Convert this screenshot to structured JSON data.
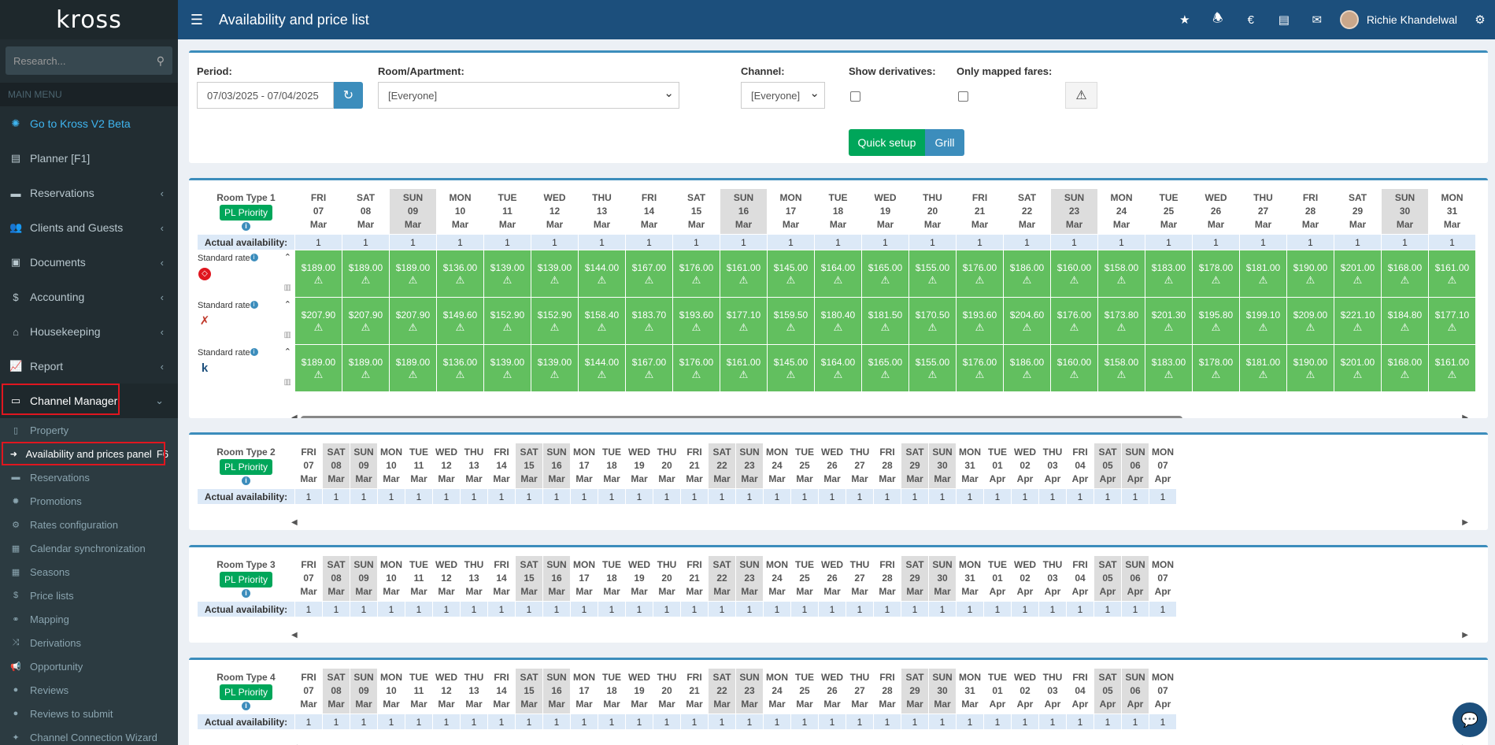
{
  "app": {
    "logo": "kross",
    "page_title": "Availability and price list"
  },
  "search": {
    "placeholder": "Research..."
  },
  "sidebar": {
    "menu_header": "MAIN MENU",
    "items": [
      {
        "label": "Go to Kross V2 Beta",
        "icon": "flower-icon"
      },
      {
        "label": "Planner [F1]",
        "icon": "planner-icon"
      },
      {
        "label": "Reservations",
        "icon": "book-icon"
      },
      {
        "label": "Clients and Guests",
        "icon": "users-icon"
      },
      {
        "label": "Documents",
        "icon": "document-icon"
      },
      {
        "label": "Accounting",
        "icon": "dollar-icon"
      },
      {
        "label": "Housekeeping",
        "icon": "house-icon"
      },
      {
        "label": "Report",
        "icon": "chart-icon"
      },
      {
        "label": "Channel Manager",
        "icon": "monitor-icon"
      }
    ],
    "sub_items": [
      {
        "label": "Property",
        "icon": "file-icon"
      },
      {
        "label": "Availability and prices panel",
        "shortcut": "F6",
        "icon": "login-icon"
      },
      {
        "label": "Reservations",
        "icon": "book-icon"
      },
      {
        "label": "Promotions",
        "icon": "certificate-icon"
      },
      {
        "label": "Rates configuration",
        "icon": "gear-icon"
      },
      {
        "label": "Calendar synchronization",
        "icon": "calendar-icon"
      },
      {
        "label": "Seasons",
        "icon": "calendar-icon"
      },
      {
        "label": "Price lists",
        "icon": "dollar-icon"
      },
      {
        "label": "Mapping",
        "icon": "link-icon"
      },
      {
        "label": "Derivations",
        "icon": "shuffle-icon"
      },
      {
        "label": "Opportunity",
        "icon": "bullhorn-icon"
      },
      {
        "label": "Reviews",
        "icon": "comment-icon"
      },
      {
        "label": "Reviews to submit",
        "icon": "comment-icon"
      },
      {
        "label": "Channel Connection Wizard",
        "icon": "wand-icon"
      }
    ]
  },
  "topbar": {
    "user_name": "Richie Khandelwal",
    "euro": "€"
  },
  "filters": {
    "period_label": "Period:",
    "period_value": "07/03/2025 - 07/04/2025",
    "room_label": "Room/Apartment:",
    "room_value": "[Everyone]",
    "channel_label": "Channel:",
    "channel_value": "[Everyone]",
    "derivatives_label": "Show derivatives:",
    "mapped_label": "Only mapped fares:",
    "quick_setup": "Quick setup",
    "grill": "Grill"
  },
  "grid": {
    "pl_priority": "PL Priority",
    "actual_availability": "Actual availability:",
    "standard_rate": "Standard rate",
    "rt1_days": [
      [
        "FRI",
        "07",
        "Mar",
        0
      ],
      [
        "SAT",
        "08",
        "Mar",
        0
      ],
      [
        "SUN",
        "09",
        "Mar",
        1
      ],
      [
        "MON",
        "10",
        "Mar",
        0
      ],
      [
        "TUE",
        "11",
        "Mar",
        0
      ],
      [
        "WED",
        "12",
        "Mar",
        0
      ],
      [
        "THU",
        "13",
        "Mar",
        0
      ],
      [
        "FRI",
        "14",
        "Mar",
        0
      ],
      [
        "SAT",
        "15",
        "Mar",
        0
      ],
      [
        "SUN",
        "16",
        "Mar",
        1
      ],
      [
        "MON",
        "17",
        "Mar",
        0
      ],
      [
        "TUE",
        "18",
        "Mar",
        0
      ],
      [
        "WED",
        "19",
        "Mar",
        0
      ],
      [
        "THU",
        "20",
        "Mar",
        0
      ],
      [
        "FRI",
        "21",
        "Mar",
        0
      ],
      [
        "SAT",
        "22",
        "Mar",
        0
      ],
      [
        "SUN",
        "23",
        "Mar",
        1
      ],
      [
        "MON",
        "24",
        "Mar",
        0
      ],
      [
        "TUE",
        "25",
        "Mar",
        0
      ],
      [
        "WED",
        "26",
        "Mar",
        0
      ],
      [
        "THU",
        "27",
        "Mar",
        0
      ],
      [
        "FRI",
        "28",
        "Mar",
        0
      ],
      [
        "SAT",
        "29",
        "Mar",
        0
      ],
      [
        "SUN",
        "30",
        "Mar",
        1
      ],
      [
        "MON",
        "31",
        "Mar",
        0
      ]
    ],
    "all_days": [
      [
        "FRI",
        "07",
        "Mar",
        0
      ],
      [
        "SAT",
        "08",
        "Mar",
        1
      ],
      [
        "SUN",
        "09",
        "Mar",
        1
      ],
      [
        "MON",
        "10",
        "Mar",
        0
      ],
      [
        "TUE",
        "11",
        "Mar",
        0
      ],
      [
        "WED",
        "12",
        "Mar",
        0
      ],
      [
        "THU",
        "13",
        "Mar",
        0
      ],
      [
        "FRI",
        "14",
        "Mar",
        0
      ],
      [
        "SAT",
        "15",
        "Mar",
        1
      ],
      [
        "SUN",
        "16",
        "Mar",
        1
      ],
      [
        "MON",
        "17",
        "Mar",
        0
      ],
      [
        "TUE",
        "18",
        "Mar",
        0
      ],
      [
        "WED",
        "19",
        "Mar",
        0
      ],
      [
        "THU",
        "20",
        "Mar",
        0
      ],
      [
        "FRI",
        "21",
        "Mar",
        0
      ],
      [
        "SAT",
        "22",
        "Mar",
        1
      ],
      [
        "SUN",
        "23",
        "Mar",
        1
      ],
      [
        "MON",
        "24",
        "Mar",
        0
      ],
      [
        "TUE",
        "25",
        "Mar",
        0
      ],
      [
        "WED",
        "26",
        "Mar",
        0
      ],
      [
        "THU",
        "27",
        "Mar",
        0
      ],
      [
        "FRI",
        "28",
        "Mar",
        0
      ],
      [
        "SAT",
        "29",
        "Mar",
        1
      ],
      [
        "SUN",
        "30",
        "Mar",
        1
      ],
      [
        "MON",
        "31",
        "Mar",
        0
      ],
      [
        "TUE",
        "01",
        "Apr",
        0
      ],
      [
        "WED",
        "02",
        "Apr",
        0
      ],
      [
        "THU",
        "03",
        "Apr",
        0
      ],
      [
        "FRI",
        "04",
        "Apr",
        0
      ],
      [
        "SAT",
        "05",
        "Apr",
        1
      ],
      [
        "SUN",
        "06",
        "Apr",
        1
      ],
      [
        "MON",
        "07",
        "Apr",
        0
      ]
    ],
    "rooms": [
      {
        "name": "Room Type 1",
        "rates": [
          {
            "channel_icon": "airbnb-icon",
            "logo_color": "#e0161f",
            "prices": [
              "$189.00",
              "$189.00",
              "$189.00",
              "$136.00",
              "$139.00",
              "$139.00",
              "$144.00",
              "$167.00",
              "$176.00",
              "$161.00",
              "$145.00",
              "$164.00",
              "$165.00",
              "$155.00",
              "$176.00",
              "$186.00",
              "$160.00",
              "$158.00",
              "$183.00",
              "$178.00",
              "$181.00",
              "$190.00",
              "$201.00",
              "$168.00",
              "$161.00"
            ]
          },
          {
            "channel_icon": "expedia-icon",
            "logo_color": "#c0392b",
            "prices": [
              "$207.90",
              "$207.90",
              "$207.90",
              "$149.60",
              "$152.90",
              "$152.90",
              "$158.40",
              "$183.70",
              "$193.60",
              "$177.10",
              "$159.50",
              "$180.40",
              "$181.50",
              "$170.50",
              "$193.60",
              "$204.60",
              "$176.00",
              "$173.80",
              "$201.30",
              "$195.80",
              "$199.10",
              "$209.00",
              "$221.10",
              "$184.80",
              "$177.10"
            ]
          },
          {
            "channel_icon": "kross-icon",
            "logo_color": "#1c4f7c",
            "prices": [
              "$189.00",
              "$189.00",
              "$189.00",
              "$136.00",
              "$139.00",
              "$139.00",
              "$144.00",
              "$167.00",
              "$176.00",
              "$161.00",
              "$145.00",
              "$164.00",
              "$165.00",
              "$155.00",
              "$176.00",
              "$186.00",
              "$160.00",
              "$158.00",
              "$183.00",
              "$178.00",
              "$181.00",
              "$190.00",
              "$201.00",
              "$168.00",
              "$161.00"
            ]
          }
        ]
      },
      {
        "name": "Room Type 2"
      },
      {
        "name": "Room Type 3"
      },
      {
        "name": "Room Type 4"
      }
    ]
  }
}
